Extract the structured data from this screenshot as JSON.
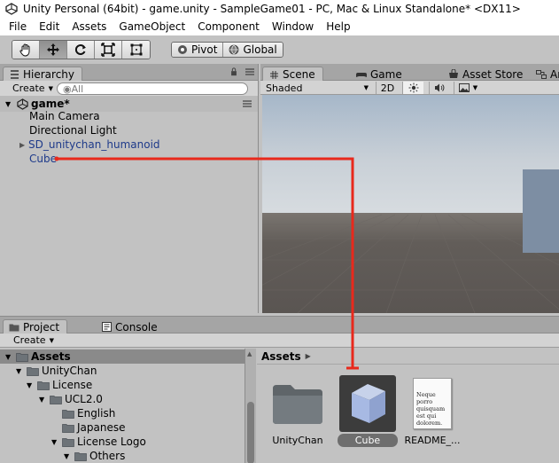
{
  "window": {
    "title": "Unity Personal (64bit) - game.unity - SampleGame01 - PC, Mac & Linux Standalone* <DX11>"
  },
  "menu": [
    "File",
    "Edit",
    "Assets",
    "GameObject",
    "Component",
    "Window",
    "Help"
  ],
  "toolbar": {
    "tools": [
      "hand-tool-icon",
      "move-tool-icon",
      "rotate-tool-icon",
      "scale-tool-icon",
      "rect-tool-icon"
    ],
    "active_tool": 1,
    "pivot_label": "Pivot",
    "global_label": "Global"
  },
  "hierarchy": {
    "tab_label": "Hierarchy",
    "create_label": "Create",
    "search_placeholder": "◉All",
    "scene_name": "game*",
    "items": [
      {
        "label": "Main Camera"
      },
      {
        "label": "Directional Light"
      },
      {
        "label": "SD_unitychan_humanoid"
      },
      {
        "label": "Cube"
      }
    ]
  },
  "scene_panel": {
    "tabs": [
      "Scene",
      "Game",
      "Asset Store",
      "Ar"
    ],
    "shading_mode": "Shaded",
    "mode_2d_label": "2D",
    "colors": {
      "sky_top": "#a6b7c9",
      "sky_horizon": "#d7dce0",
      "ground": "#5f5b58",
      "cube_face": "#7d8ea3"
    }
  },
  "project": {
    "tab_label": "Project",
    "console_label": "Console",
    "create_label": "Create",
    "tree": [
      {
        "label": "Assets",
        "depth": 0,
        "selected": true
      },
      {
        "label": "UnityChan",
        "depth": 1
      },
      {
        "label": "License",
        "depth": 2
      },
      {
        "label": "UCL2.0",
        "depth": 3
      },
      {
        "label": "English",
        "depth": 4
      },
      {
        "label": "Japanese",
        "depth": 4
      },
      {
        "label": "License Logo",
        "depth": 3
      },
      {
        "label": "Others",
        "depth": 4
      }
    ],
    "breadcrumb": "Assets",
    "assets": [
      {
        "label": "UnityChan",
        "kind": "folder"
      },
      {
        "label": "Cube",
        "kind": "prefab",
        "selected": true
      },
      {
        "label": "README_...",
        "kind": "document",
        "preview_text": "Neque porro quisquam est qui dolorem."
      }
    ]
  },
  "annotation": {
    "color": "#e8291c"
  }
}
